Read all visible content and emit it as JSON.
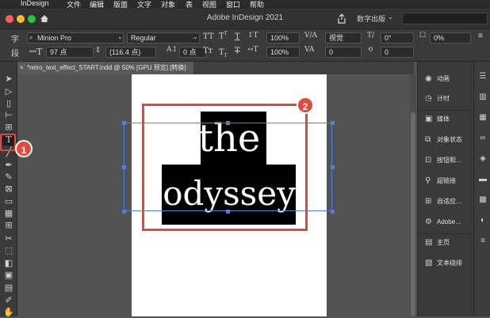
{
  "menubar": {
    "items": [
      "InDesign",
      "文件",
      "编辑",
      "版面",
      "文字",
      "对象",
      "表",
      "视图",
      "窗口",
      "帮助"
    ]
  },
  "titlebar": {
    "title": "Adobe InDesign 2021",
    "workspace": "数字出版"
  },
  "control": {
    "font_family": "Minion Pro",
    "font_style": "Regular",
    "font_size": "97 点",
    "leading": "(116.4 点)",
    "kerning_mode": "视觉",
    "tracking": "0",
    "vertical_scale": "100%",
    "horizontal_scale": "100%",
    "baseline_shift": "0 点",
    "skew": "0°",
    "kerning_value": "0",
    "tsume": "0%",
    "superscript": "T",
    "subscript": "T",
    "char_glyph": "字",
    "para_glyph": "段"
  },
  "document": {
    "tab_label": "*retro_text_effect_START.indd @ 50% [GPU 预览] [转换]",
    "line1": "the",
    "line2": "odyssey"
  },
  "callouts": {
    "one": "1",
    "two": "2"
  },
  "dock": {
    "items": [
      "动画",
      "计时",
      "媒体",
      "对象状态",
      "按钮和…",
      "超链接",
      "自适应…",
      "Adobe…",
      "主页",
      "文本绕排"
    ]
  },
  "colors": {
    "accent": "#e04a3c",
    "selection": "#4b7fe0",
    "text_fill": "#000000",
    "text": "#ffffff"
  },
  "icons": {
    "toolbar": [
      "selection-tool",
      "direct-selection-tool",
      "page-tool",
      "gap-tool",
      "content-collector-tool",
      "type-tool",
      "line-tool",
      "pen-tool",
      "pencil-tool",
      "rectangle-frame-tool",
      "rectangle-tool",
      "table-tool",
      "grid-tool",
      "scissors-tool",
      "free-transform-tool",
      "gradient-swatch-tool",
      "gradient-feather-tool",
      "note-tool",
      "eyedropper-tool",
      "hand-tool"
    ]
  }
}
